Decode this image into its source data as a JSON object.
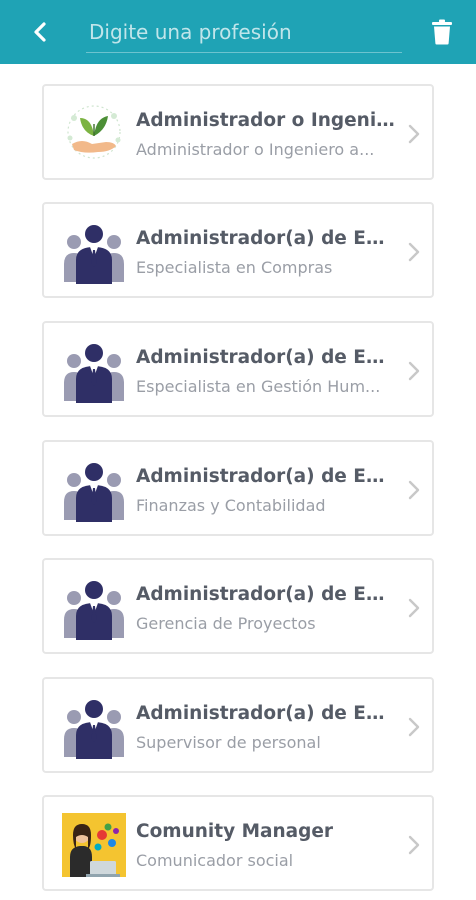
{
  "header": {
    "search_placeholder": "Digite una profesión",
    "back_icon": "chevron-left-icon",
    "clear_icon": "trash-icon",
    "bar_color": "#1fa3b5"
  },
  "items": [
    {
      "title": "Administrador o Ingenier...",
      "subtitle": "Administrador o Ingeniero a...",
      "icon": "eco-hand-leaves-icon"
    },
    {
      "title": "Administrador(a) de Emp...",
      "subtitle": "Especialista en Compras",
      "icon": "business-people-icon"
    },
    {
      "title": "Administrador(a) de Emp...",
      "subtitle": "Especialista en Gestión Hum...",
      "icon": "business-people-icon"
    },
    {
      "title": "Administrador(a) de Emp...",
      "subtitle": "Finanzas y Contabilidad",
      "icon": "business-people-icon"
    },
    {
      "title": "Administrador(a) de Emp...",
      "subtitle": "Gerencia de Proyectos",
      "icon": "business-people-icon"
    },
    {
      "title": "Administrador(a) de Emp...",
      "subtitle": "Supervisor de personal",
      "icon": "business-people-icon"
    },
    {
      "title": "Comunity Manager",
      "subtitle": "Comunicador social",
      "icon": "community-manager-icon"
    }
  ]
}
